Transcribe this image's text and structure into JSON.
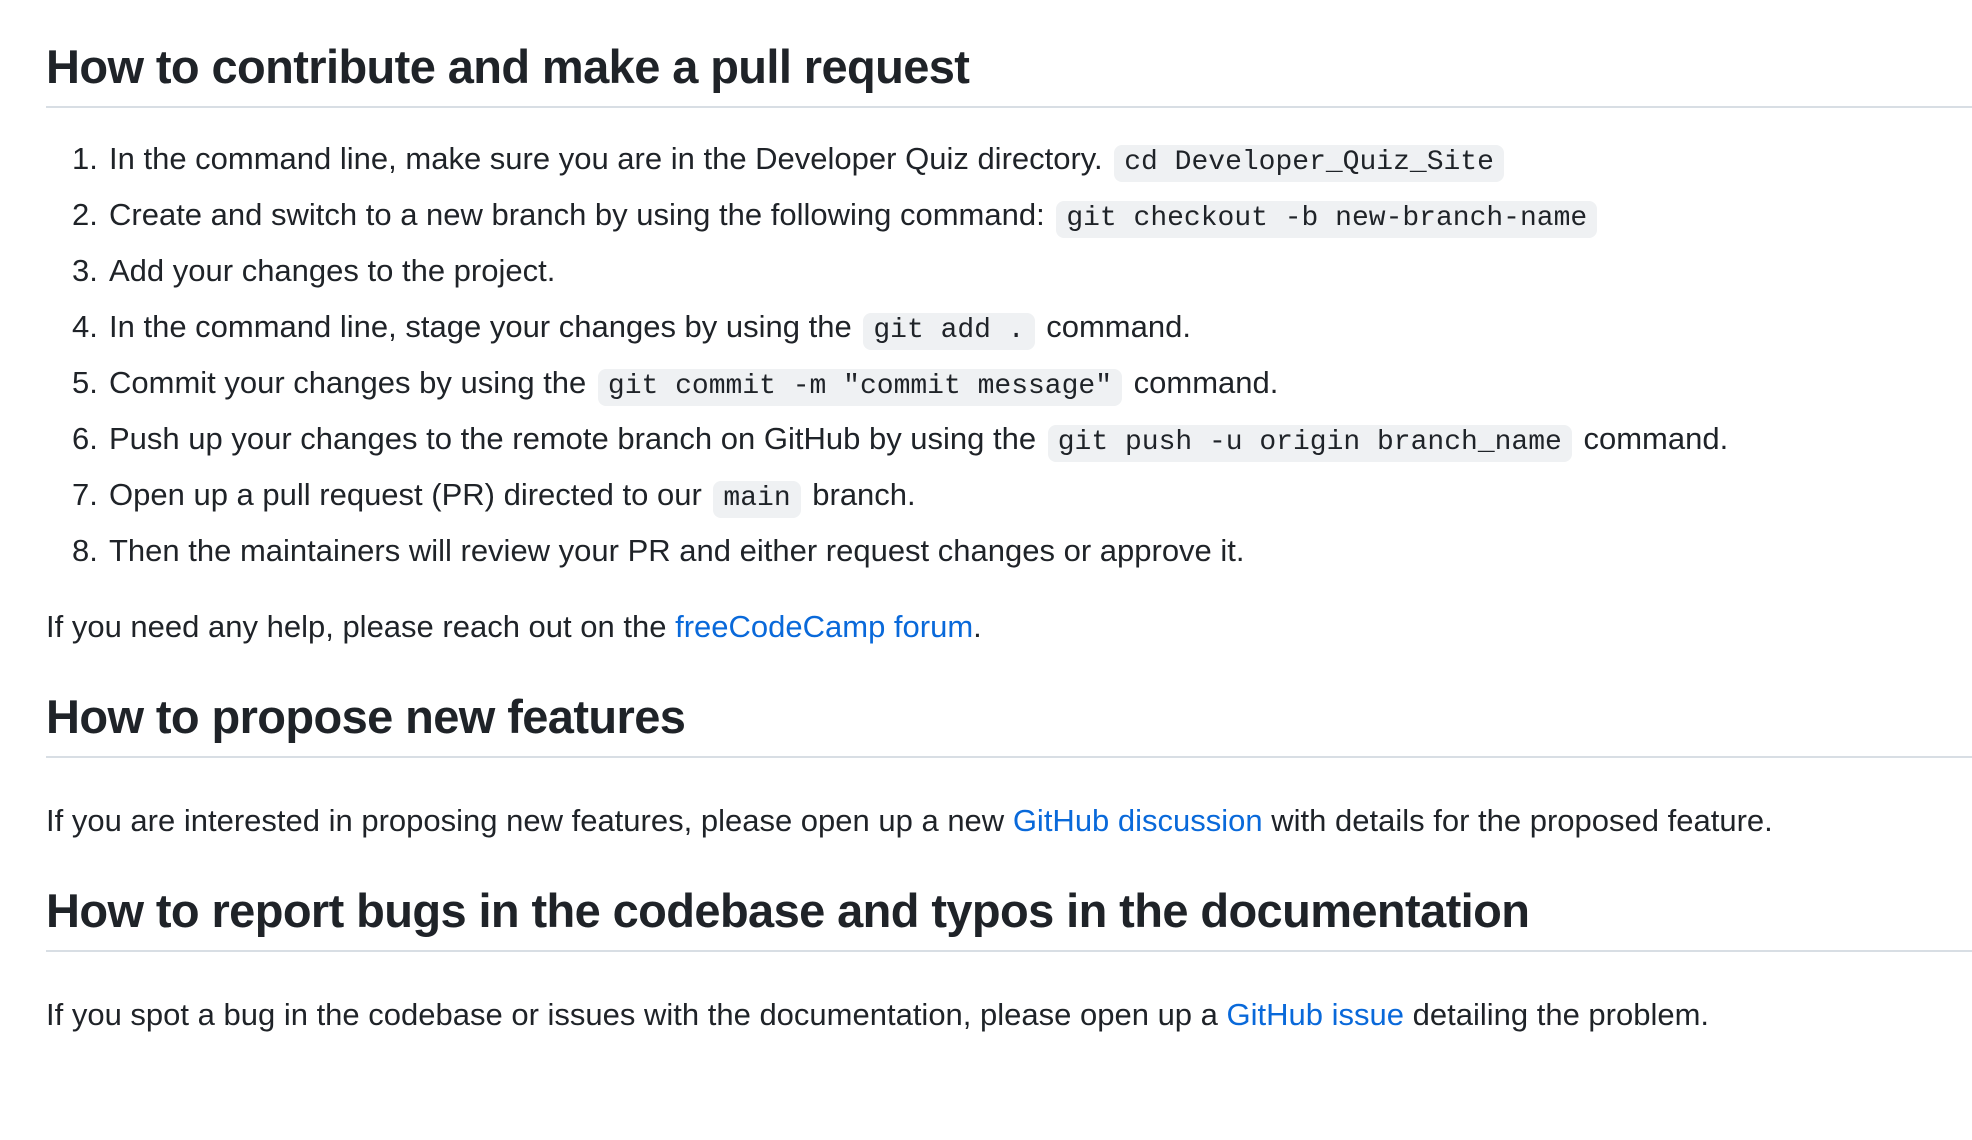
{
  "contribute": {
    "heading": "How to contribute and make a pull request",
    "steps": [
      {
        "before": "In the command line, make sure you are in the Developer Quiz directory.",
        "code": "cd Developer_Quiz_Site",
        "after": ""
      },
      {
        "before": "Create and switch to a new branch by using the following command:",
        "code": "git checkout -b new-branch-name",
        "after": ""
      },
      {
        "before": "Add your changes to the project.",
        "code": "",
        "after": ""
      },
      {
        "before": "In the command line, stage your changes by using the",
        "code": "git add .",
        "after": "command."
      },
      {
        "before": "Commit your changes by using the",
        "code": "git commit -m \"commit message\"",
        "after": "command."
      },
      {
        "before": "Push up your changes to the remote branch on GitHub by using the",
        "code": "git push -u origin branch_name",
        "after": "command."
      },
      {
        "before": "Open up a pull request (PR) directed to our",
        "code": "main",
        "after": "branch."
      },
      {
        "before": "Then the maintainers will review your PR and either request changes or approve it.",
        "code": "",
        "after": ""
      }
    ],
    "help_before": "If you need any help, please reach out on the",
    "help_link": "freeCodeCamp forum",
    "help_after": "."
  },
  "propose": {
    "heading": "How to propose new features",
    "text_before": "If you are interested in proposing new features, please open up a new",
    "link": "GitHub discussion",
    "text_after": "with details for the proposed feature."
  },
  "report": {
    "heading": "How to report bugs in the codebase and typos in the documentation",
    "text_before": "If you spot a bug in the codebase or issues with the documentation, please open up a",
    "link": "GitHub issue",
    "text_after": "detailing the problem."
  },
  "colors": {
    "text": "#1f2328",
    "link": "#0969da",
    "code_bg": "#eff1f3",
    "rule": "#d8dee4"
  }
}
